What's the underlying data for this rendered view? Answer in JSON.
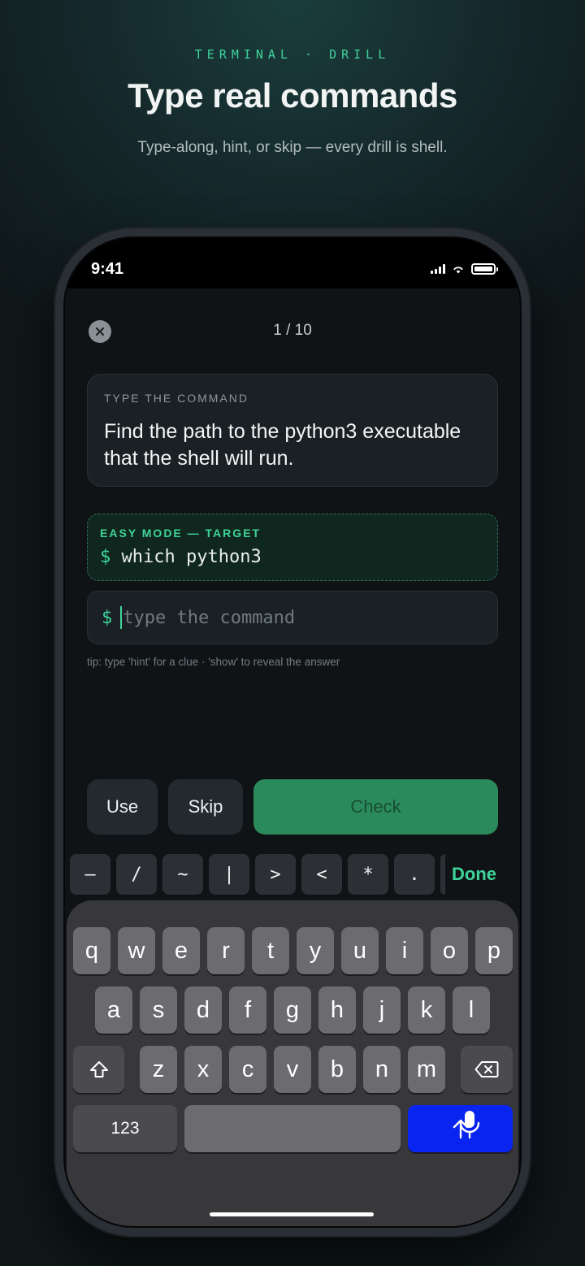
{
  "header": {
    "eyebrow": "TERMINAL · DRILL",
    "title": "Type real commands",
    "subtitle": "Type-along, hint, or skip — every drill is shell."
  },
  "status_bar": {
    "time": "9:41"
  },
  "drill": {
    "progress": "1 / 10",
    "prompt_label": "TYPE THE COMMAND",
    "prompt_text": "Find the path to the python3 executable that the shell will run.",
    "target_label": "EASY MODE — TARGET",
    "target_prompt": "$",
    "target_command": "which python3",
    "input_prompt": "$",
    "input_placeholder": "type the command",
    "tip": "tip: type 'hint' for a clue · 'show' to reveal the answer"
  },
  "actions": {
    "use": "Use",
    "skip": "Skip",
    "check": "Check"
  },
  "accessory": {
    "keys": [
      "–",
      "/",
      "~",
      "|",
      ">",
      "<",
      "*",
      "."
    ],
    "done": "Done"
  },
  "keyboard": {
    "row1": [
      "q",
      "w",
      "e",
      "r",
      "t",
      "y",
      "u",
      "i",
      "o",
      "p"
    ],
    "row2": [
      "a",
      "s",
      "d",
      "f",
      "g",
      "h",
      "j",
      "k",
      "l"
    ],
    "row3": [
      "z",
      "x",
      "c",
      "v",
      "b",
      "n",
      "m"
    ],
    "numbers_key": "123"
  },
  "colors": {
    "accent": "#3fd49a",
    "check_button": "#2b8a5c",
    "return_key": "#0a24f0"
  },
  "icons": [
    "close-icon",
    "signal-icon",
    "wifi-icon",
    "battery-icon",
    "shift-icon",
    "delete-icon",
    "return-arrow-icon",
    "microphone-icon"
  ]
}
